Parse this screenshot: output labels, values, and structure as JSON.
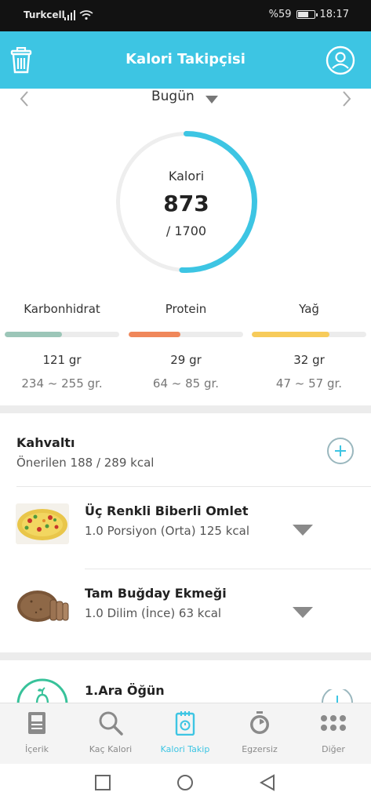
{
  "status_bar": {
    "carrier": "Turkcell",
    "battery": "%59",
    "time": "18:17"
  },
  "header": {
    "title": "Kalori Takipçisi"
  },
  "date_nav": {
    "label": "Bugün"
  },
  "calorie_ring": {
    "label": "Kalori",
    "consumed": "873",
    "goal": "/ 1700",
    "progress": 0.51,
    "color": "#3dc5e3"
  },
  "macros": [
    {
      "name": "Karbonhidrat",
      "amount": "121 gr",
      "range": "234 ~ 255 gr.",
      "progress": 0.5,
      "color": "#9cc6b8"
    },
    {
      "name": "Protein",
      "amount": "29 gr",
      "range": "64 ~ 85 gr.",
      "progress": 0.45,
      "color": "#f0875a"
    },
    {
      "name": "Yağ",
      "amount": "32 gr",
      "range": "47 ~ 57 gr.",
      "progress": 0.68,
      "color": "#f7cb5a"
    }
  ],
  "breakfast": {
    "title": "Kahvaltı",
    "subtitle": "Önerilen 188 / 289 kcal",
    "items": [
      {
        "name": "Üç Renkli Biberli Omlet",
        "detail": "1.0 Porsiyon (Orta) 125 kcal"
      },
      {
        "name": "Tam Buğday Ekmeği",
        "detail": "1.0 Dilim (İnce) 63 kcal"
      }
    ]
  },
  "snack": {
    "title": "1.Ara Öğün"
  },
  "bottom_nav": [
    {
      "label": "İçerik",
      "icon": "document-icon"
    },
    {
      "label": "Kaç Kalori",
      "icon": "search-icon"
    },
    {
      "label": "Kalori Takip",
      "icon": "tracker-icon"
    },
    {
      "label": "Egzersiz",
      "icon": "stopwatch-icon"
    },
    {
      "label": "Diğer",
      "icon": "more-dots-icon"
    }
  ]
}
